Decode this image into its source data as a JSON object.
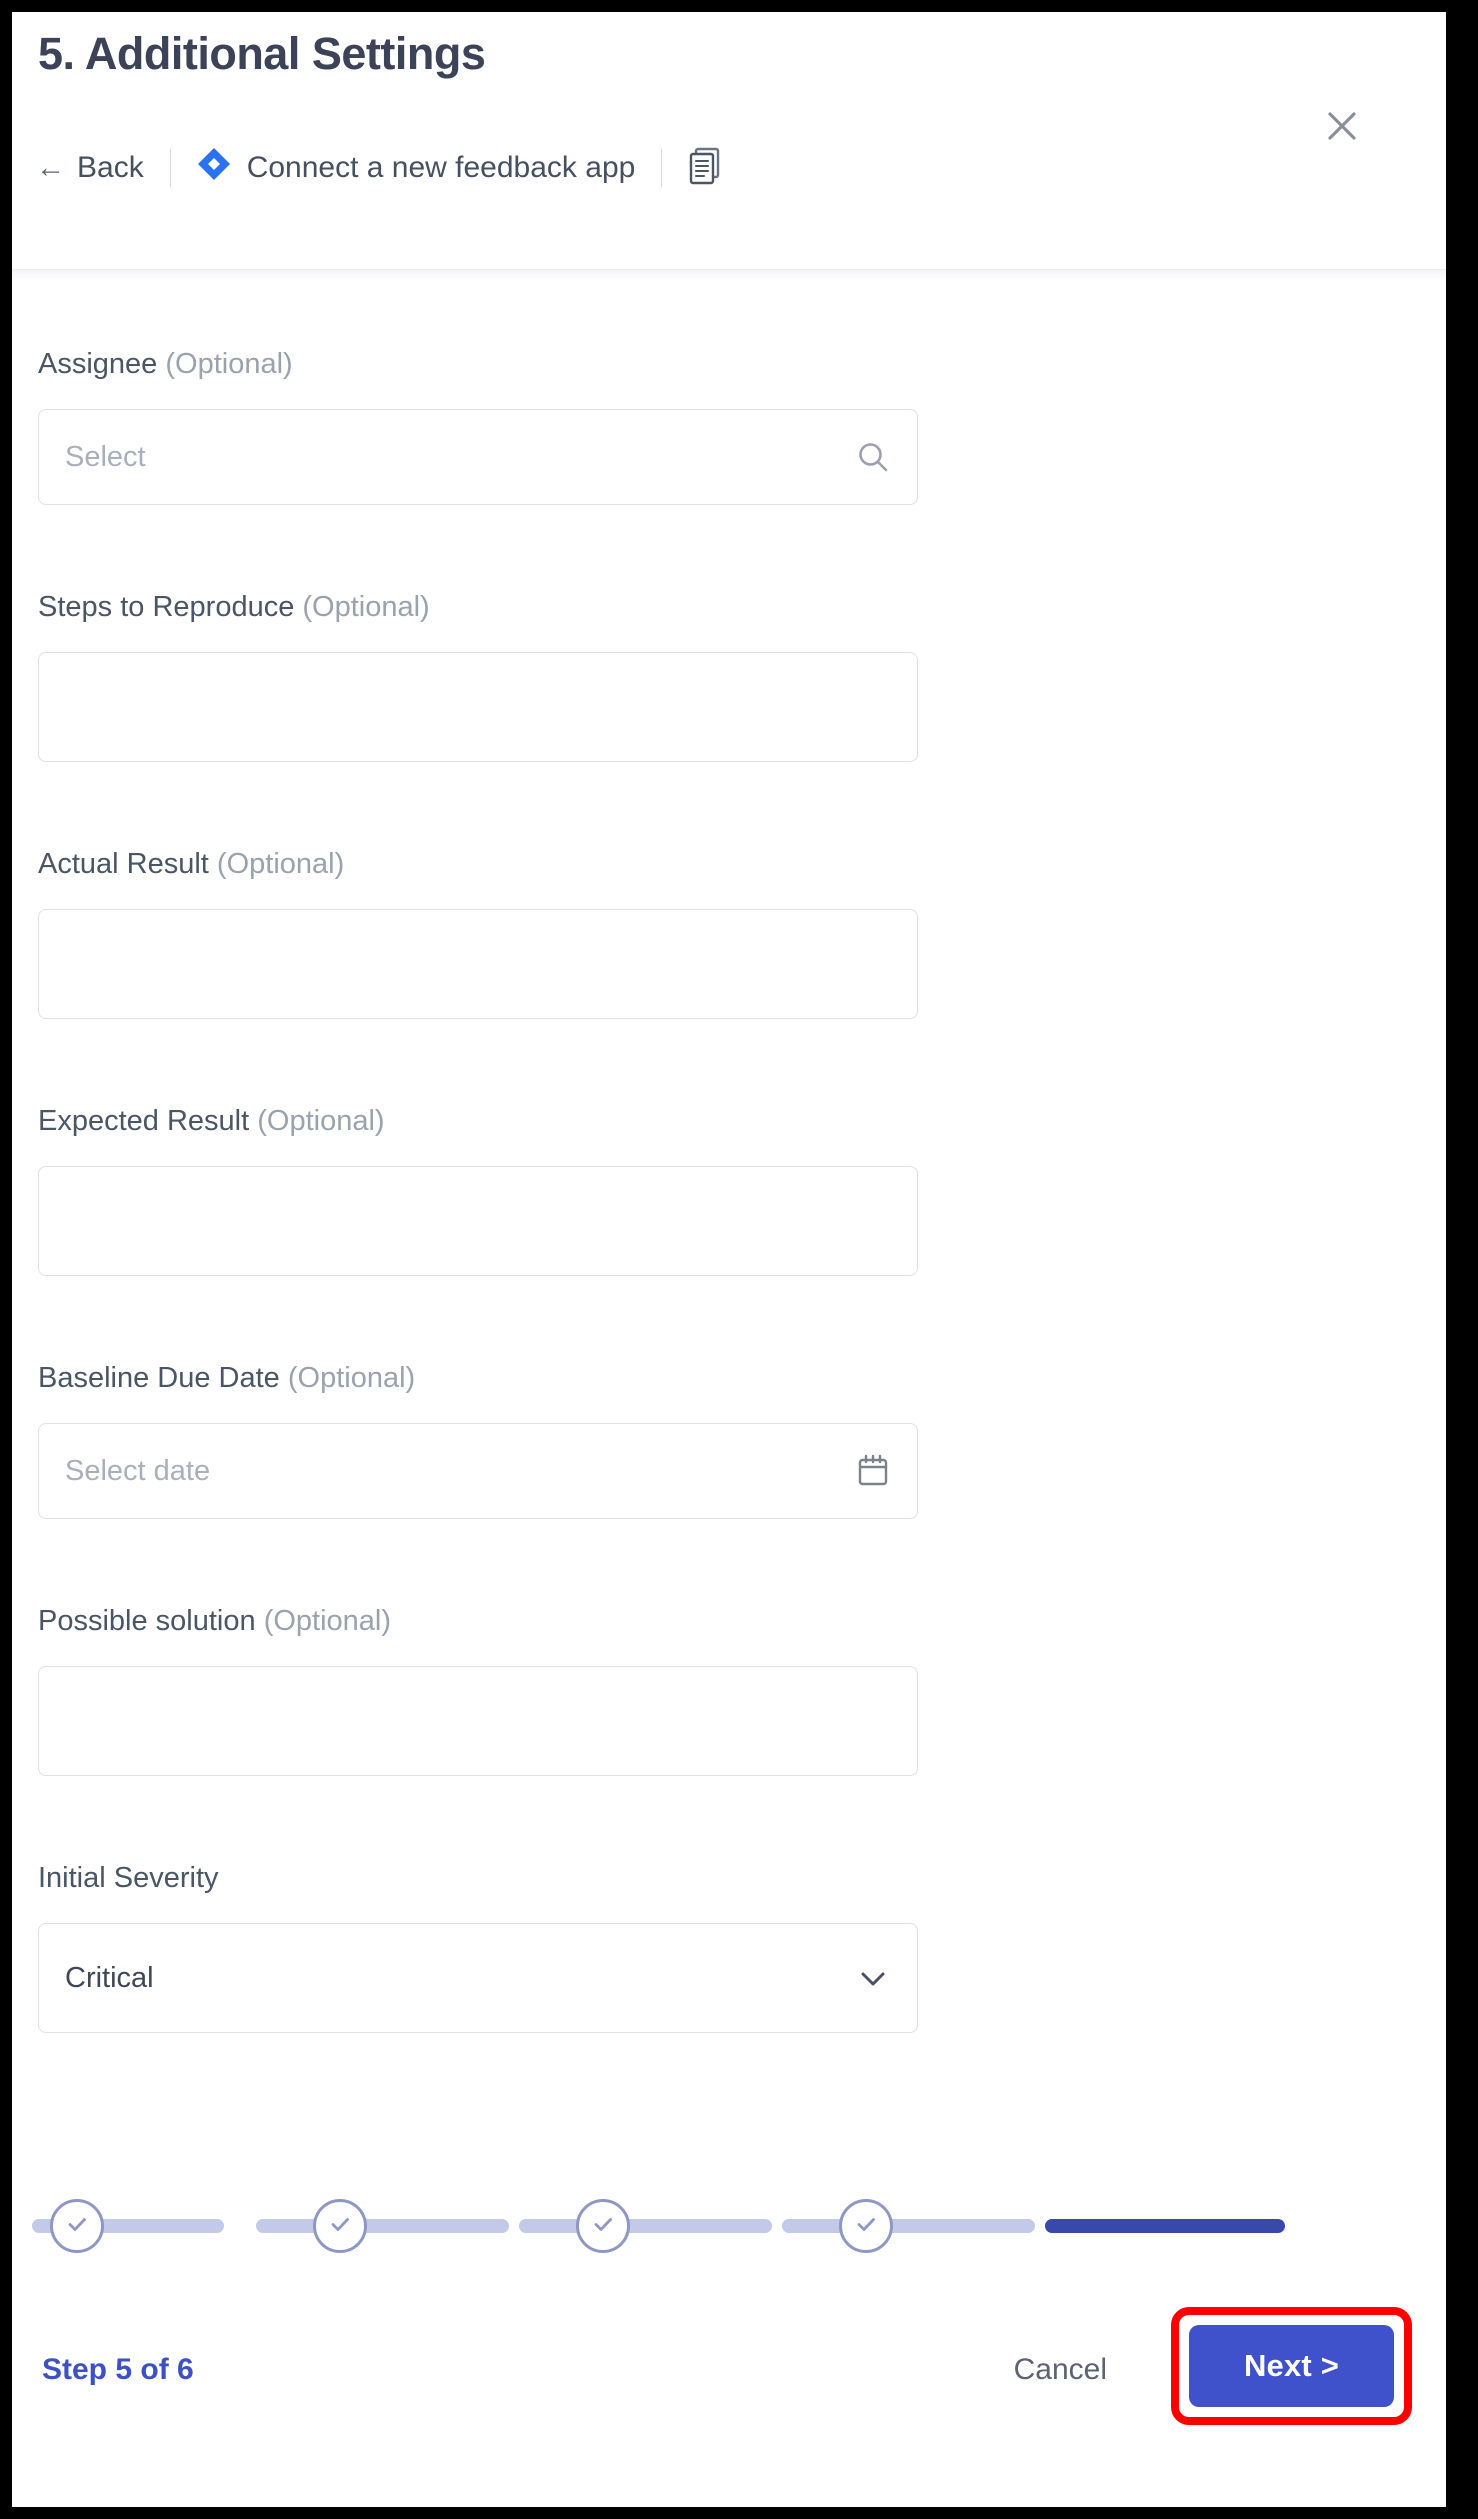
{
  "header": {
    "title": "5. Additional Settings",
    "close_label": "×",
    "back_label": "Back",
    "back_arrow": "←",
    "app_label": "Connect a new feedback app",
    "doc_icon_name": "documents-icon",
    "jira_icon_name": "jira-diamond-icon",
    "accent_blue": "#2563eb"
  },
  "form": {
    "fields": [
      {
        "label": "Assignee",
        "optional": "(Optional)",
        "type": "select-search",
        "placeholder": "Select",
        "value": "",
        "icon": "search-icon"
      },
      {
        "label": "Steps to Reproduce",
        "optional": "(Optional)",
        "type": "text",
        "placeholder": "",
        "value": "",
        "icon": ""
      },
      {
        "label": "Actual Result",
        "optional": "(Optional)",
        "type": "text",
        "placeholder": "",
        "value": "",
        "icon": ""
      },
      {
        "label": "Expected Result",
        "optional": "(Optional)",
        "type": "text",
        "placeholder": "",
        "value": "",
        "icon": ""
      },
      {
        "label": "Baseline Due Date",
        "optional": "(Optional)",
        "type": "date",
        "placeholder": "Select date",
        "value": "",
        "icon": "calendar-icon"
      },
      {
        "label": "Possible solution",
        "optional": "(Optional)",
        "type": "text",
        "placeholder": "",
        "value": "",
        "icon": ""
      },
      {
        "label": "Initial Severity",
        "optional": "",
        "type": "dropdown",
        "placeholder": "",
        "value": "Critical",
        "icon": "chevron-down-icon"
      }
    ]
  },
  "stepper": {
    "total_steps": 6,
    "current_step": 5,
    "completed_icon": "check-icon",
    "completed_color": "#c3c9e8",
    "active_color": "#3949ab"
  },
  "footer": {
    "step_text": "Step 5 of 6",
    "cancel_label": "Cancel",
    "next_label": "Next >",
    "next_color": "#3f51cb",
    "highlight_color": "#ff0000"
  }
}
